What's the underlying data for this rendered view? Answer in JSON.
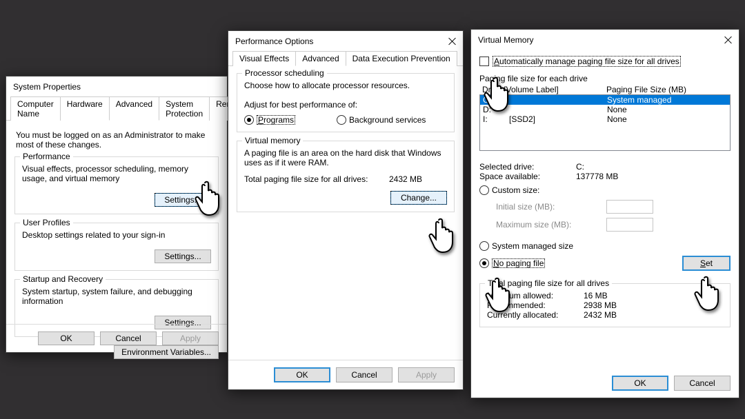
{
  "sysprops": {
    "title": "System Properties",
    "tabs": [
      "Computer Name",
      "Hardware",
      "Advanced",
      "System Protection",
      "Remote"
    ],
    "intro": "You must be logged on as an Administrator to make most of these changes.",
    "perf": {
      "title": "Performance",
      "desc": "Visual effects, processor scheduling, memory usage, and virtual memory",
      "btn": "Settings..."
    },
    "userprof": {
      "title": "User Profiles",
      "desc": "Desktop settings related to your sign-in",
      "btn": "Settings..."
    },
    "startup": {
      "title": "Startup and Recovery",
      "desc": "System startup, system failure, and debugging information",
      "btn": "Settings..."
    },
    "envbtn": "Environment Variables...",
    "ok": "OK",
    "cancel": "Cancel",
    "apply": "Apply"
  },
  "perfopt": {
    "title": "Performance Options",
    "tabs": [
      "Visual Effects",
      "Advanced",
      "Data Execution Prevention"
    ],
    "sched": {
      "title": "Processor scheduling",
      "desc": "Choose how to allocate processor resources.",
      "adjust": "Adjust for best performance of:",
      "programs": "Programs",
      "bg": "Background services"
    },
    "vm": {
      "title": "Virtual memory",
      "desc": "A paging file is an area on the hard disk that Windows uses as if it were RAM.",
      "total_label": "Total paging file size for all drives:",
      "total_value": "2432 MB",
      "change": "Change..."
    },
    "ok": "OK",
    "cancel": "Cancel",
    "apply": "Apply"
  },
  "vmem": {
    "title": "Virtual Memory",
    "auto": "Automatically manage paging file size for all drives",
    "each": "Paging file size for each drive",
    "col_drive": "Drive [Volume Label]",
    "col_size": "Paging File Size (MB)",
    "drives": [
      {
        "letter": "C:",
        "label": "",
        "size": "System managed"
      },
      {
        "letter": "D:",
        "label": "",
        "size": "None"
      },
      {
        "letter": "I:",
        "label": "[SSD2]",
        "size": "None"
      }
    ],
    "selected_drive_label": "Selected drive:",
    "selected_drive": "C:",
    "space_label": "Space available:",
    "space": "137778 MB",
    "custom": "Custom size:",
    "initial": "Initial size (MB):",
    "maximum": "Maximum size (MB):",
    "sysmanaged": "System managed size",
    "nopaging": "No paging file",
    "set": "Set",
    "totals_title": "Total paging file size for all drives",
    "min_label": "Minimum allowed:",
    "min": "16 MB",
    "rec_label": "Recommended:",
    "rec": "2938 MB",
    "cur_label": "Currently allocated:",
    "cur": "2432 MB",
    "ok": "OK",
    "cancel": "Cancel"
  }
}
